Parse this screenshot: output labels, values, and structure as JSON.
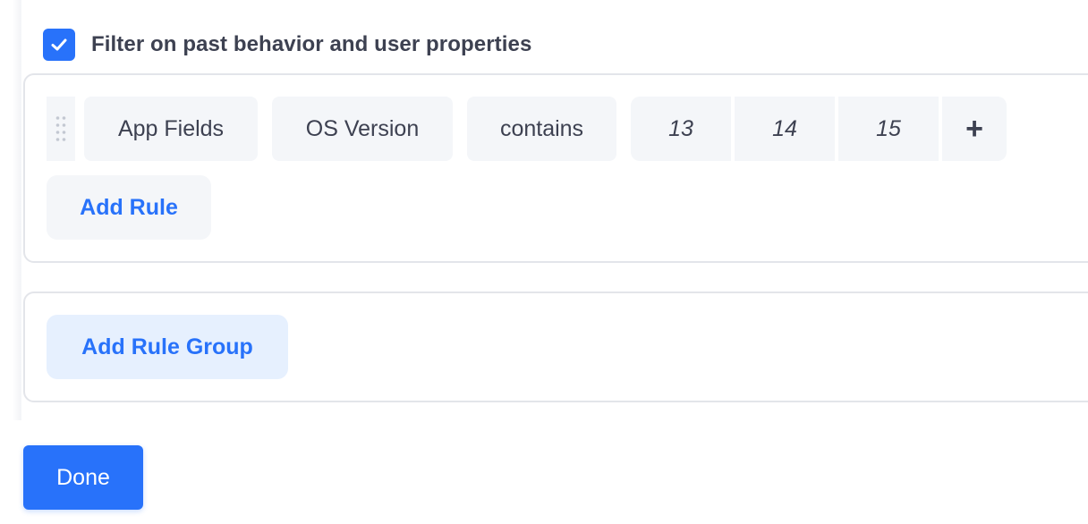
{
  "filter": {
    "checked": true,
    "label": "Filter on past behavior and user properties"
  },
  "rule": {
    "category": "App Fields",
    "field": "OS Version",
    "operator": "contains",
    "values": [
      "13",
      "14",
      "15"
    ],
    "add_value_symbol": "+"
  },
  "buttons": {
    "add_rule": "Add Rule",
    "add_rule_group": "Add Rule Group",
    "done": "Done"
  },
  "colors": {
    "accent": "#2872fa",
    "chip_bg": "#f4f6f9",
    "group_button_bg": "#e6f0fe",
    "border": "#e3e5ea",
    "text": "#3d4151"
  }
}
